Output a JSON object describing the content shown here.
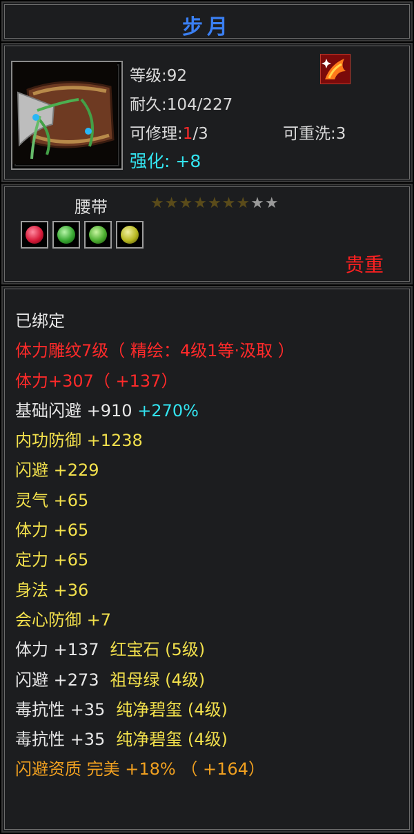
{
  "title": "步月",
  "info": {
    "level_label": "等级",
    "level_value": ":92",
    "durability_label": "耐久",
    "durability_value": ":104/227",
    "repair_label": "可修理",
    "repair_sep": ":",
    "repair_current": "1",
    "repair_total": "/3",
    "rewash_label": "可重洗",
    "rewash_value": ":3",
    "enhance_label": "强化:",
    "enhance_value": "+8",
    "item_icon": "belt-icon",
    "badge_icon": "phoenix-badge-icon"
  },
  "type_section": {
    "item_type": "腰带",
    "stars_filled": 7,
    "stars_total": 9,
    "gems": [
      {
        "icon": "red-gem-icon",
        "color": "#d81b3a"
      },
      {
        "icon": "green-gem-icon",
        "color": "#38a832"
      },
      {
        "icon": "green-gem-icon",
        "color": "#4cae30"
      },
      {
        "icon": "yellow-gem-icon",
        "color": "#b8b820"
      }
    ],
    "rarity": "贵重"
  },
  "attributes": [
    {
      "color": "white",
      "parts": [
        "已绑定"
      ]
    },
    {
      "color": "red",
      "parts": [
        "体力雕纹7级（ 精绘：4级1等·汲取 ）"
      ]
    },
    {
      "color": "red",
      "parts": [
        "体力+307（ +137）"
      ]
    },
    {
      "color": "white",
      "parts": [
        "基础闪避 +910"
      ],
      "extra": "+270%"
    },
    {
      "color": "yellow",
      "parts": [
        "内功防御 +1238"
      ]
    },
    {
      "color": "yellow",
      "parts": [
        "闪避 +229"
      ]
    },
    {
      "color": "yellow",
      "parts": [
        "灵气 +65"
      ]
    },
    {
      "color": "yellow",
      "parts": [
        "体力 +65"
      ]
    },
    {
      "color": "yellow",
      "parts": [
        "定力 +65"
      ]
    },
    {
      "color": "yellow",
      "parts": [
        "身法 +36"
      ]
    },
    {
      "color": "yellow",
      "parts": [
        "会心防御 +7"
      ]
    },
    {
      "color": "white",
      "parts": [
        "体力 +137"
      ],
      "gem": "红宝石 (5级)"
    },
    {
      "color": "white",
      "parts": [
        "闪避 +273"
      ],
      "gem": "祖母绿 (4级)"
    },
    {
      "color": "white",
      "parts": [
        "毒抗性 +35"
      ],
      "gem": "纯净碧玺 (4级)"
    },
    {
      "color": "white",
      "parts": [
        "毒抗性 +35"
      ],
      "gem": "纯净碧玺 (4级)"
    },
    {
      "color": "orange",
      "parts": [
        "闪避资质 完美 +18% （ +164）"
      ]
    }
  ]
}
